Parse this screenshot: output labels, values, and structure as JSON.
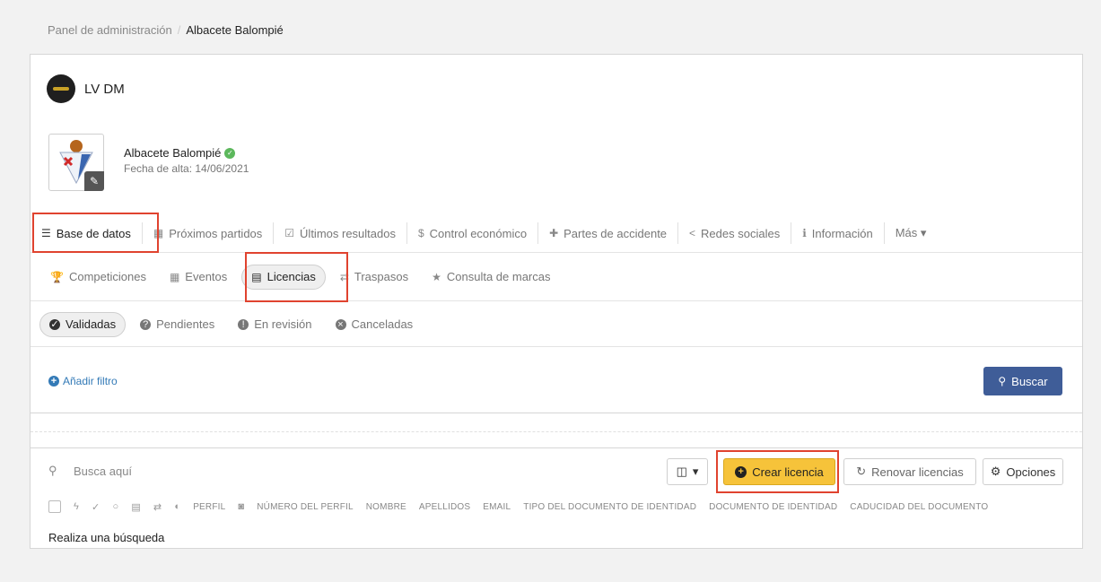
{
  "breadcrumb": {
    "root": "Panel de administración",
    "separator": "/",
    "current": "Albacete Balompié"
  },
  "org": {
    "name": "LV DM"
  },
  "club": {
    "name": "Albacete Balompié",
    "date_label": "Fecha de alta: 14/06/2021"
  },
  "main_tabs": [
    {
      "label": "Base de datos",
      "icon": "database-icon",
      "glyph": "☰"
    },
    {
      "label": "Próximos partidos",
      "icon": "calendar-icon",
      "glyph": "▦"
    },
    {
      "label": "Últimos resultados",
      "icon": "calendar-check-icon",
      "glyph": "☑"
    },
    {
      "label": "Control económico",
      "icon": "dollar-icon",
      "glyph": "$"
    },
    {
      "label": "Partes de accidente",
      "icon": "medkit-icon",
      "glyph": "✚"
    },
    {
      "label": "Redes sociales",
      "icon": "share-icon",
      "glyph": "<"
    },
    {
      "label": "Información",
      "icon": "info-icon",
      "glyph": "ℹ"
    },
    {
      "label": "Más ▾",
      "icon": "caret-down-icon",
      "glyph": ""
    }
  ],
  "sub_tabs": [
    {
      "label": "Competiciones",
      "icon": "trophy-icon",
      "glyph": "🏆"
    },
    {
      "label": "Eventos",
      "icon": "calendar-icon",
      "glyph": "▦"
    },
    {
      "label": "Licencias",
      "icon": "id-card-icon",
      "glyph": "▤"
    },
    {
      "label": "Traspasos",
      "icon": "exchange-icon",
      "glyph": "⇄"
    },
    {
      "label": "Consulta de marcas",
      "icon": "star-icon",
      "glyph": "★"
    }
  ],
  "state_tabs": [
    {
      "label": "Validadas",
      "glyph": "✓"
    },
    {
      "label": "Pendientes",
      "glyph": "?"
    },
    {
      "label": "En revisión",
      "glyph": "!"
    },
    {
      "label": "Canceladas",
      "glyph": "×"
    }
  ],
  "filter": {
    "add_label": "Añadir filtro",
    "search_button": "Buscar"
  },
  "list": {
    "search_placeholder": "Busca aquí",
    "columns_button": "▾",
    "create_button": "Crear licencia",
    "renew_button": "Renovar licencias",
    "options_button": "Opciones",
    "empty_message": "Realiza una búsqueda",
    "headers": [
      "PERFIL",
      "NÚMERO DEL PERFIL",
      "NOMBRE",
      "APELLIDOS",
      "EMAIL",
      "TIPO DEL DOCUMENTO DE IDENTIDAD",
      "DOCUMENTO DE IDENTIDAD",
      "CADUCIDAD DEL DOCUMENTO"
    ]
  },
  "colors": {
    "accent": "#3f5d98",
    "create": "#f6c33a",
    "highlight": "#e0432f",
    "verified": "#5cb85c"
  }
}
